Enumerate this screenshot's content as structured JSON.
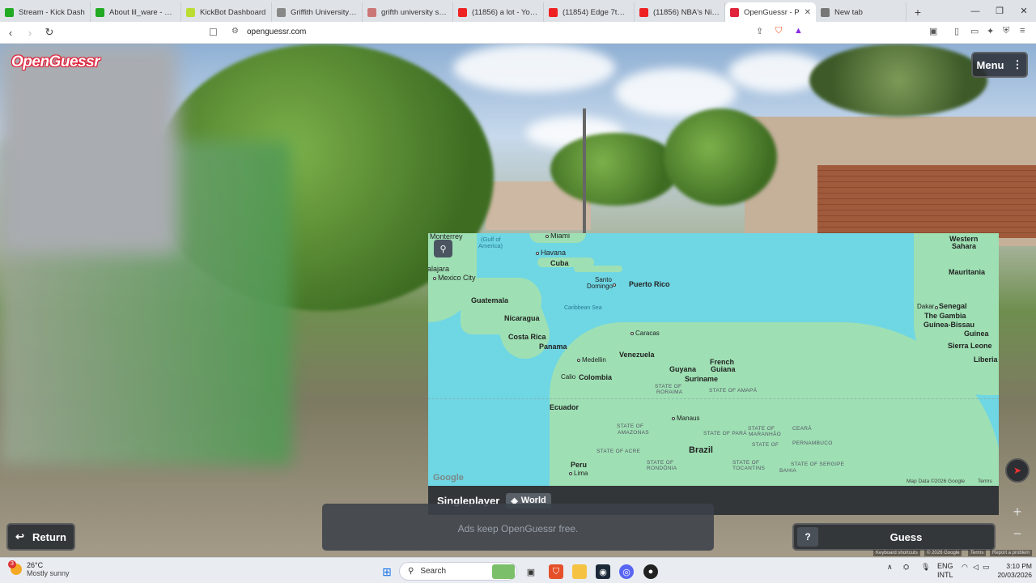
{
  "browser": {
    "tabs": [
      {
        "label": "Stream - Kick Dash",
        "color": "#2a2"
      },
      {
        "label": "About lil_ware - Watch",
        "color": "#2a2"
      },
      {
        "label": "KickBot Dashboard",
        "color": "#bd3"
      },
      {
        "label": "Griffith University Spo",
        "color": "#888"
      },
      {
        "label": "grifth university sports",
        "color": "#c77"
      },
      {
        "label": "(11856) a lot - YouTub",
        "color": "#e22"
      },
      {
        "label": "(11854) Edge 7th WWI",
        "color": "#e22"
      },
      {
        "label": "(11856) NBA's Nightly",
        "color": "#e22"
      },
      {
        "label": "OpenGuessr - P",
        "color": "#e0243b",
        "active": true
      },
      {
        "label": "New tab",
        "color": "#777"
      }
    ],
    "url": "openguessr.com"
  },
  "game": {
    "logo": "OpenGuessr",
    "menu_label": "Menu",
    "return_label": "Return",
    "guess_label": "Guess",
    "help_label": "?",
    "mode_label": "Singleplayer",
    "map_label": "World",
    "ad_text": "Ads keep OpenGuessr free."
  },
  "map": {
    "google_label": "Google",
    "map_data": "Map Data ©2026 Google",
    "terms": "Terms",
    "labels": {
      "monterrey": "Monterrey",
      "gulf": "(Gulf of",
      "america": "America)",
      "miami": "Miami",
      "havana": "Havana",
      "cuba": "Cuba",
      "alajara": "alajara",
      "mexico_city": "Mexico City",
      "santo": "Santo",
      "domingo": "Domingo",
      "puerto_rico": "Puerto Rico",
      "guatemala": "Guatemala",
      "caribbean": "Caribbean Sea",
      "nicaragua": "Nicaragua",
      "costa_rica": "Costa Rica",
      "panama": "Panama",
      "caracas": "Caracas",
      "venezuela": "Venezuela",
      "medellin": "Medellin",
      "cali": "Calio",
      "colombia": "Colombia",
      "french": "French",
      "guiana": "Guiana",
      "guyana": "Guyana",
      "suriname": "Suriname",
      "roraima": "STATE OF",
      "roraima2": "RORAIMA",
      "amapa": "STATE OF AMAPÁ",
      "ecuador": "Ecuador",
      "manaus": "Manaus",
      "para": "STATE OF PARÁ",
      "maranhao": "MARANHÃO",
      "ceara": "CEARÁ",
      "amazonas": "STATE OF",
      "amazonas2": "AMAZONAS",
      "state_of": "STATE OF",
      "brazil": "Brazil",
      "acre": "STATE OF ACRE",
      "peru": "Peru",
      "lima": "Lima",
      "rondonia": "RONDÔNIA",
      "tocantins": "TOCANTINS",
      "bahia": "BAHIA",
      "sergipe": "STATE OF SERGIPE",
      "pernambuco": "PERNAMBUCO",
      "western_sahara_1": "Western",
      "western_sahara_2": "Sahara",
      "mauritania": "Mauritania",
      "dakar": "Dakar",
      "senegal": "Senegal",
      "gambia": "The Gambia",
      "guinea_bissau": "Guinea-Bissau",
      "guinea": "Guinea",
      "sierra_leone": "Sierra Leone",
      "liberia": "Liberia"
    }
  },
  "google_footer": {
    "shortcuts": "Keyboard shortcuts",
    "copy": "© 2026 Google",
    "terms": "Terms",
    "report": "Report a problem"
  },
  "taskbar": {
    "weather_temp": "26°C",
    "weather_desc": "Mostly sunny",
    "weather_badge": "3",
    "search_placeholder": "Search",
    "lang1": "ENG",
    "lang2": "INTL",
    "time": "3:10 PM",
    "date": "20/03/2026"
  }
}
